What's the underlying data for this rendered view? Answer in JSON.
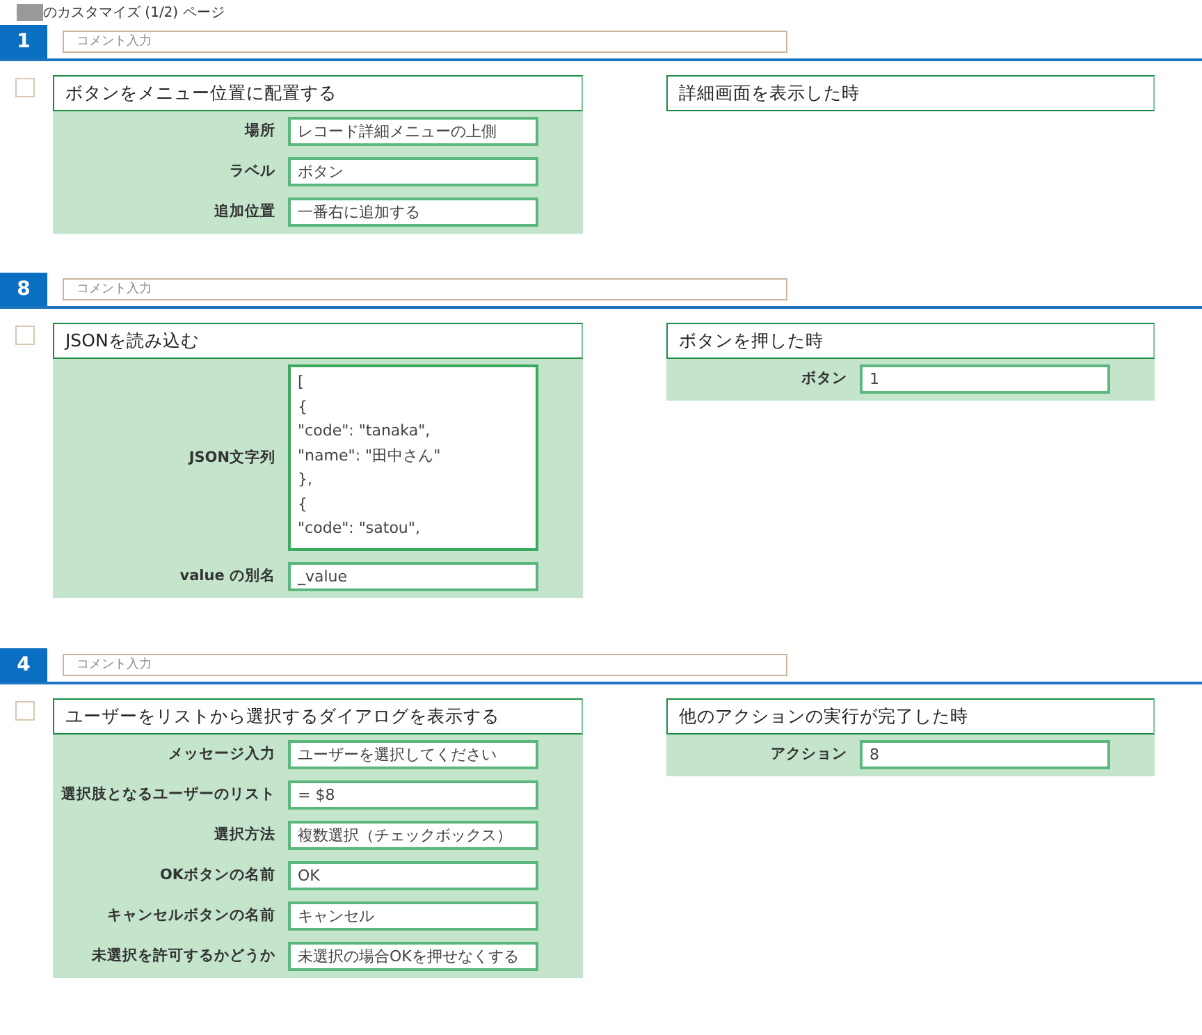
{
  "page_title": "のカスタマイズ (1/2) ページ",
  "sections": [
    {
      "number": "1",
      "comment_placeholder": "コメント入力",
      "checked": false,
      "action": {
        "title": "ボタンをメニュー位置に配置する",
        "fields": [
          {
            "kind": "input",
            "label": "場所",
            "value": "レコード詳細メニューの上側"
          },
          {
            "kind": "input",
            "label": "ラベル",
            "value": "ボタン"
          },
          {
            "kind": "input",
            "label": "追加位置",
            "value": "一番右に追加する"
          }
        ]
      },
      "trigger": {
        "title": "詳細画面を表示した時"
      }
    },
    {
      "number": "8",
      "comment_placeholder": "コメント入力",
      "checked": false,
      "action": {
        "title": "JSONを読み込む",
        "fields": [
          {
            "kind": "textarea",
            "label": "JSON文字列",
            "lines": [
              "[",
              "{",
              "\"code\": \"tanaka\",",
              "\"name\": \"田中さん\"",
              "},",
              "{",
              "\"code\": \"satou\","
            ]
          },
          {
            "kind": "input",
            "label": "value の別名",
            "value": "_value"
          }
        ]
      },
      "trigger": {
        "title": "ボタンを押した時",
        "fields": [
          {
            "kind": "input",
            "label": "ボタン",
            "value": "1"
          }
        ]
      }
    },
    {
      "number": "4",
      "comment_placeholder": "コメント入力",
      "checked": false,
      "action": {
        "title": "ユーザーをリストから選択するダイアログを表示する",
        "fields": [
          {
            "kind": "input",
            "label": "メッセージ入力",
            "value": "ユーザーを選択してください"
          },
          {
            "kind": "input",
            "label": "選択肢となるユーザーのリスト",
            "value": "= $8"
          },
          {
            "kind": "input",
            "label": "選択方法",
            "value": "複数選択（チェックボックス）"
          },
          {
            "kind": "input",
            "label": "OKボタンの名前",
            "value": "OK"
          },
          {
            "kind": "input",
            "label": "キャンセルボタンの名前",
            "value": "キャンセル"
          },
          {
            "kind": "input",
            "label": "未選択を許可するかどうか",
            "value": "未選択の場合OKを押せなくする"
          }
        ]
      },
      "trigger": {
        "title": "他のアクションの実行が完了した時",
        "fields": [
          {
            "kind": "input",
            "label": "アクション",
            "value": "8"
          }
        ]
      }
    }
  ]
}
